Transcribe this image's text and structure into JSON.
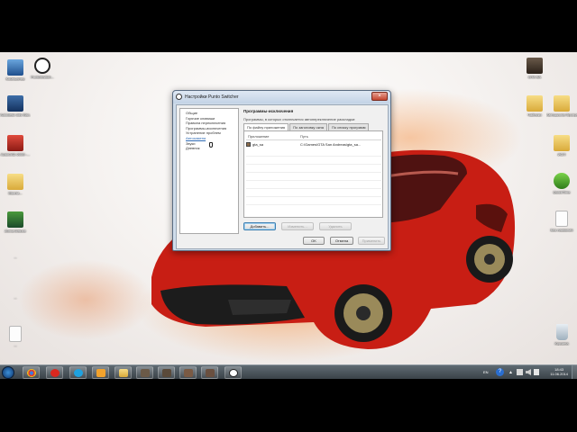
{
  "desktop": {
    "icons_left": [
      {
        "label": "Компьютер"
      },
      {
        "label": "PuntoSwitch..."
      },
      {
        "label": "Autodesk 3ds Max..."
      },
      {
        "label": "AutoCAD 2009 -..."
      },
      {
        "label": "Монти..."
      },
      {
        "label": "Zuma Deluxe"
      },
      {
        "label": "..."
      },
      {
        "label": "..."
      },
      {
        "label": "..."
      }
    ],
    "icons_right": [
      {
        "label": "GTA SA"
      },
      {
        "label": "Чайники"
      },
      {
        "label": "Автошкола Программы"
      },
      {
        "label": "ИСП"
      },
      {
        "label": "QuickTime"
      },
      {
        "label": "Без названия"
      },
      {
        "label": "Корзина"
      }
    ]
  },
  "dialog": {
    "title": "Настройки Punto Switcher",
    "close_glyph": "×",
    "tree": [
      "Общие",
      "Горячие клавиши",
      "Правила переключения",
      "Программы-исключения",
      "Устранение проблем",
      "Автозамена",
      "Звуки",
      "Дневник"
    ],
    "tree_selected_index": 5,
    "panel": {
      "title": "Программы-исключения",
      "description": "Программы, в которых отключается автопереключение раскладки:",
      "tabs": [
        "По файлу приложения",
        "По заголовку окна",
        "По списку программ"
      ],
      "active_tab": 0,
      "columns": [
        "Приложение",
        "Путь"
      ],
      "rows": [
        {
          "app": "gta_sa",
          "path": "C:\\Games\\GTA San Andreas\\gta_sa..."
        }
      ],
      "buttons": {
        "add": "Добавить...",
        "edit": "Изменить...",
        "remove": "Удалить"
      }
    },
    "footer": {
      "ok": "OK",
      "cancel": "Отмена",
      "apply": "Применить"
    }
  },
  "taskbar": {
    "language": "EN",
    "time": "18:43",
    "date": "11.06.2014"
  },
  "colors": {
    "car_red": "#c81e14",
    "flame_orange": "#f28a3a",
    "taskbar": "#3a4248",
    "selection_blue": "#2f6bb5"
  }
}
